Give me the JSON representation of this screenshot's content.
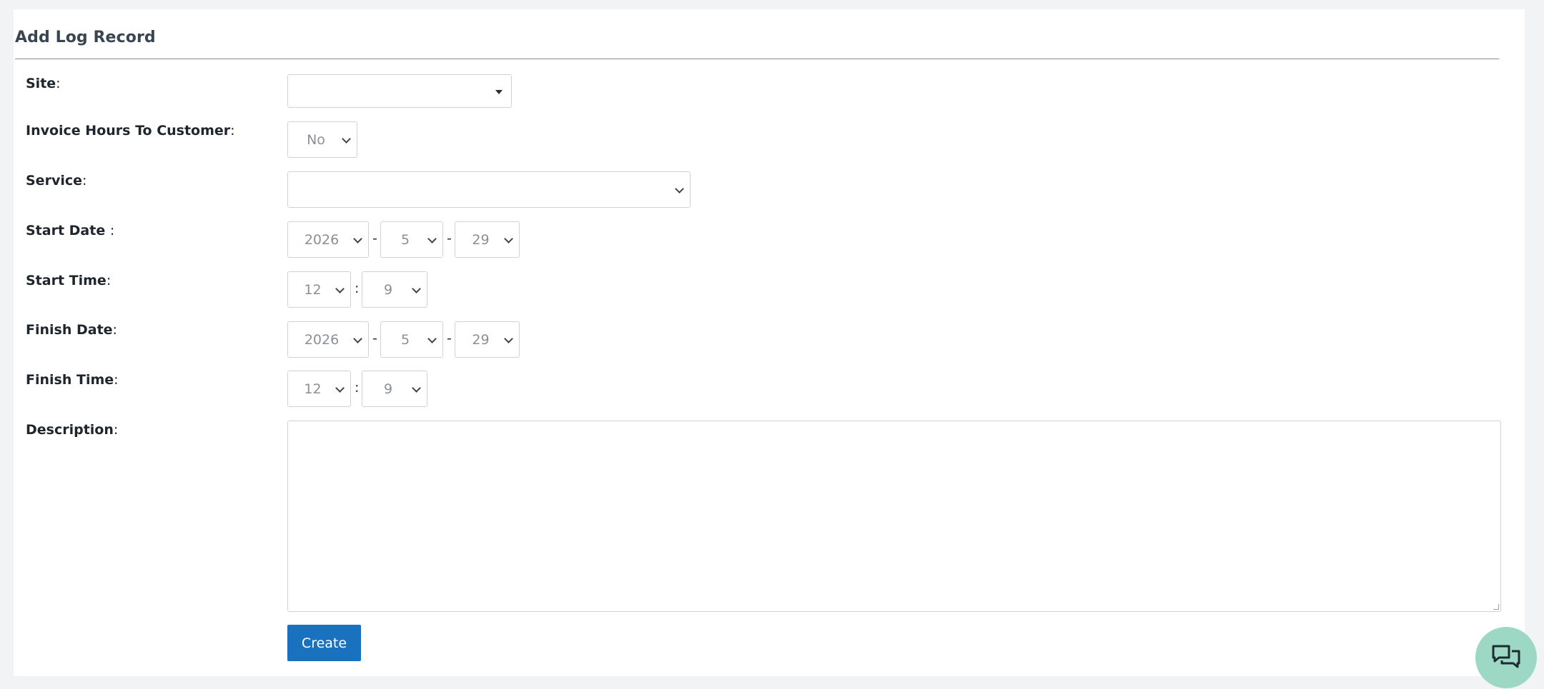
{
  "page": {
    "title": "Add Log Record"
  },
  "form": {
    "site": {
      "label": "Site",
      "colon": ":",
      "value": ""
    },
    "invoice_hours": {
      "label": "Invoice Hours To Customer",
      "colon": ":",
      "value": "No"
    },
    "service": {
      "label": "Service",
      "colon": ":",
      "value": ""
    },
    "start_date": {
      "label": "Start Date ",
      "colon": ":",
      "year": "2026",
      "month": "5",
      "day": "29",
      "separator": "-"
    },
    "start_time": {
      "label": "Start Time",
      "colon": ":",
      "hour": "12",
      "minute": "9",
      "separator": ":"
    },
    "finish_date": {
      "label": "Finish Date",
      "colon": ":",
      "year": "2026",
      "month": "5",
      "day": "29",
      "separator": "-"
    },
    "finish_time": {
      "label": "Finish Time",
      "colon": ":",
      "hour": "12",
      "minute": "9",
      "separator": ":"
    },
    "description": {
      "label": "Description",
      "colon": ":",
      "value": ""
    },
    "create_button": "Create"
  },
  "icons": {
    "chat": "chat-bubbles-icon"
  },
  "colors": {
    "primary_button": "#1a72bf",
    "chat_fab": "#9cd8c4"
  }
}
